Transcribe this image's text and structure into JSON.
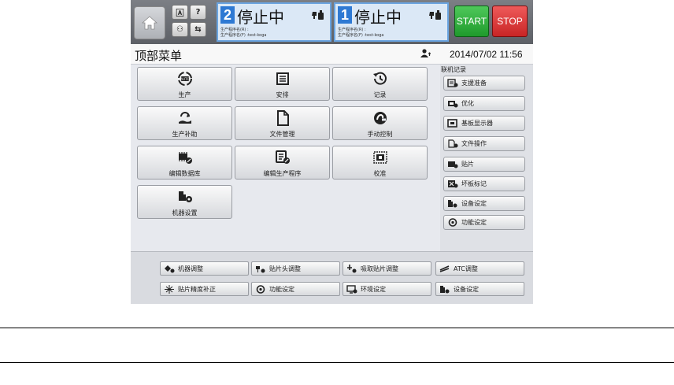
{
  "topbar": {
    "home_icon": "home-icon",
    "small_buttons": [
      {
        "glyph": "🄰",
        "icon": "display-mode-icon"
      },
      {
        "glyph": "?",
        "icon": "help-icon"
      },
      {
        "glyph": "⚇",
        "icon": "operator-icon"
      },
      {
        "glyph": "⇆",
        "icon": "transfer-icon"
      }
    ],
    "lines": [
      {
        "number": "2",
        "status": "停止中",
        "info1": "生产程序名(R) :",
        "info2": "生产程序名(F) :test-koga"
      },
      {
        "number": "1",
        "status": "停止中",
        "info1": "生产程序名(R) :",
        "info2": "生产程序名(F) :test-koga"
      }
    ],
    "start_label": "START",
    "stop_label": "STOP"
  },
  "titlebar": {
    "title": "顶部菜单",
    "datetime": "2014/07/02 11:56"
  },
  "menu": [
    {
      "label": "生产",
      "icon": "auto-production-icon"
    },
    {
      "label": "安排",
      "icon": "schedule-icon"
    },
    {
      "label": "记录",
      "icon": "history-icon"
    },
    {
      "label": "生产补助",
      "icon": "production-support-icon"
    },
    {
      "label": "文件管理",
      "icon": "file-icon"
    },
    {
      "label": "手动控制",
      "icon": "manual-control-icon"
    },
    {
      "label": "编辑数据库",
      "icon": "database-edit-icon"
    },
    {
      "label": "编辑生产程序",
      "icon": "program-edit-icon"
    },
    {
      "label": "校准",
      "icon": "calibration-icon"
    },
    {
      "label": "机器设置",
      "icon": "machine-settings-icon"
    }
  ],
  "sidepanel": {
    "title": "联机记录",
    "items": [
      {
        "label": "支援准备",
        "icon": "support-prep-icon"
      },
      {
        "label": "优化",
        "icon": "optimize-icon"
      },
      {
        "label": "基板显示器",
        "icon": "board-display-icon"
      },
      {
        "label": "文件操作",
        "icon": "file-operation-icon"
      },
      {
        "label": "贴片",
        "icon": "placement-icon"
      },
      {
        "label": "坏板标记",
        "icon": "bad-board-mark-icon"
      },
      {
        "label": "设备设定",
        "icon": "device-settings-icon"
      },
      {
        "label": "功能设定",
        "icon": "function-settings-icon"
      }
    ]
  },
  "bottom": {
    "buttons": [
      {
        "label": "机器调整",
        "icon": "machine-adjust-icon"
      },
      {
        "label": "贴片头调整",
        "icon": "head-adjust-icon"
      },
      {
        "label": "吸取贴片调整",
        "icon": "pickup-adjust-icon"
      },
      {
        "label": "ATC调整",
        "icon": "atc-adjust-icon"
      },
      {
        "label": "贴片精度补正",
        "icon": "accuracy-correction-icon"
      },
      {
        "label": "功能设定",
        "icon": "function-settings-icon"
      },
      {
        "label": "环境设定",
        "icon": "environment-settings-icon"
      },
      {
        "label": "设备设定",
        "icon": "device-settings-icon"
      }
    ]
  },
  "colors": {
    "line_number_bg": "#2e79d3",
    "start": "#2fae3b",
    "stop": "#d93636"
  }
}
